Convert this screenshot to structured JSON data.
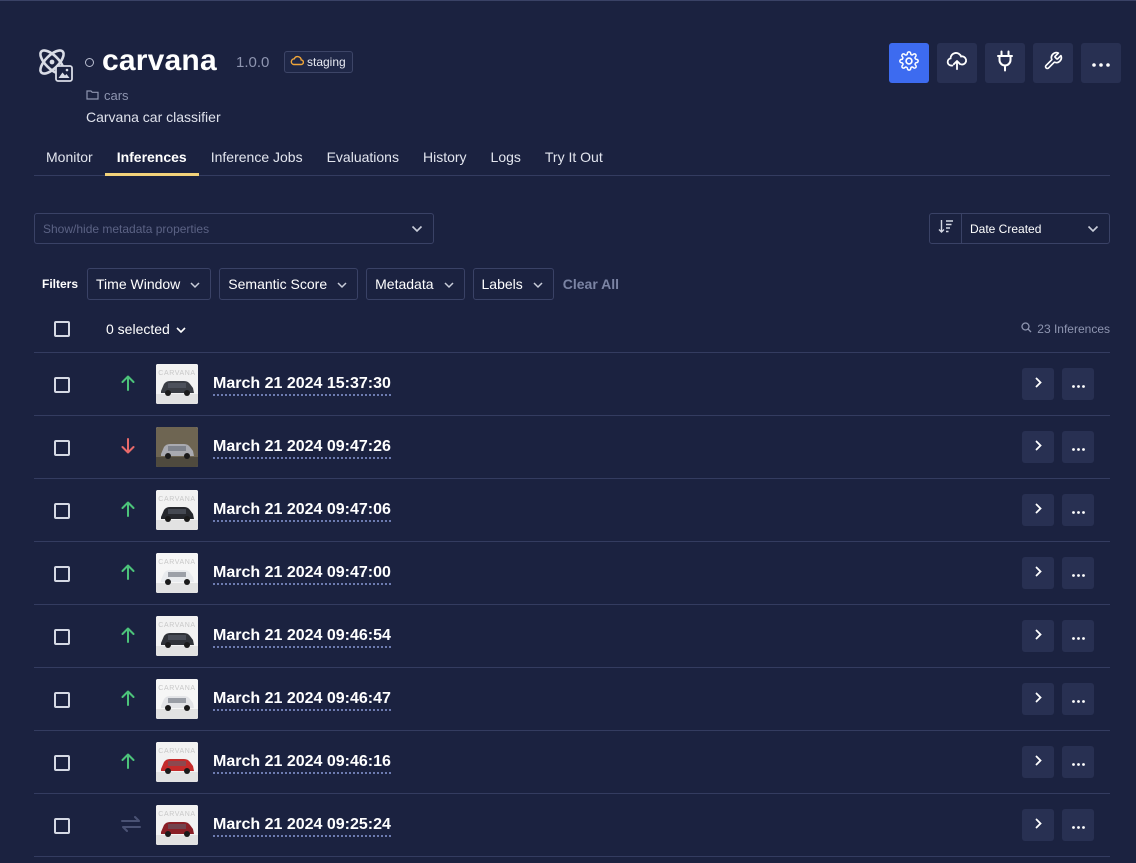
{
  "model": {
    "name": "carvana",
    "version": "1.0.0",
    "environment": "staging",
    "project": "cars",
    "description": "Carvana car classifier"
  },
  "header_buttons": [
    {
      "icon": "gear-icon",
      "active": true
    },
    {
      "icon": "cloud-upload-icon",
      "active": false
    },
    {
      "icon": "plug-icon",
      "active": false
    },
    {
      "icon": "wrench-icon",
      "active": false
    },
    {
      "icon": "ellipsis-icon",
      "active": false
    }
  ],
  "tabs": [
    "Monitor",
    "Inferences",
    "Inference Jobs",
    "Evaluations",
    "History",
    "Logs",
    "Try It Out"
  ],
  "active_tab": "Inferences",
  "metadata_select": {
    "placeholder": "Show/hide metadata properties"
  },
  "sort": {
    "label": "Date Created"
  },
  "filters": {
    "label": "Filters",
    "buttons": [
      "Time Window",
      "Semantic Score",
      "Metadata",
      "Labels"
    ],
    "clear_label": "Clear All"
  },
  "list": {
    "selected_label": "0 selected",
    "count_label": "23 Inferences"
  },
  "colors": {
    "up": "#4cc37a",
    "down": "#e86a6a",
    "neutral": "#4a5274",
    "accent": "#3d6bf0",
    "tab_underline": "#f2d27a"
  },
  "inferences": [
    {
      "timestamp": "March 21 2024 15:37:30",
      "trend": "up",
      "thumb_car": "#3a3d44",
      "thumb_bg": "#f2f2f2",
      "thumb_text": "CARVANA"
    },
    {
      "timestamp": "March 21 2024 09:47:26",
      "trend": "down",
      "thumb_car": "#a9aab0",
      "thumb_bg": "#6e6552",
      "thumb_text": ""
    },
    {
      "timestamp": "March 21 2024 09:47:06",
      "trend": "up",
      "thumb_car": "#26282d",
      "thumb_bg": "#f2f2f2",
      "thumb_text": "CARVANA"
    },
    {
      "timestamp": "March 21 2024 09:47:00",
      "trend": "up",
      "thumb_car": "#e9ebee",
      "thumb_bg": "#f6f6f6",
      "thumb_text": "CARVANA"
    },
    {
      "timestamp": "March 21 2024 09:46:54",
      "trend": "up",
      "thumb_car": "#2f3238",
      "thumb_bg": "#f2f2f2",
      "thumb_text": "CARVANA"
    },
    {
      "timestamp": "March 21 2024 09:46:47",
      "trend": "up",
      "thumb_car": "#e3e4e7",
      "thumb_bg": "#f6f6f6",
      "thumb_text": "CARVANA"
    },
    {
      "timestamp": "March 21 2024 09:46:16",
      "trend": "up",
      "thumb_car": "#c42b2b",
      "thumb_bg": "#f2f2f2",
      "thumb_text": "CARVANA"
    },
    {
      "timestamp": "March 21 2024 09:25:24",
      "trend": "neutral",
      "thumb_car": "#8a1f26",
      "thumb_bg": "#f2f2f2",
      "thumb_text": "CARVANA"
    }
  ]
}
